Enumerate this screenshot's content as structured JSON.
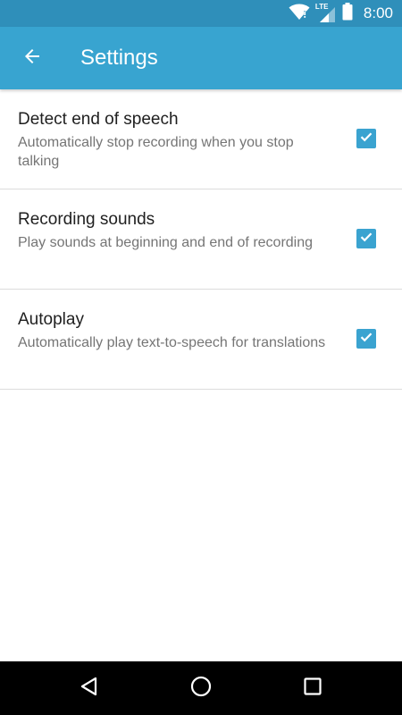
{
  "status_bar": {
    "time": "8:00",
    "network_label": "LTE",
    "icons": [
      "wifi-icon",
      "cell-signal-icon",
      "battery-icon"
    ],
    "background_color": "#2f8fba"
  },
  "app_bar": {
    "title": "Settings",
    "back_icon": "arrow-back-icon",
    "background_color": "#38a4d0"
  },
  "settings": [
    {
      "title": "Detect end of speech",
      "summary": "Automatically stop recording when you stop talking",
      "checked": true
    },
    {
      "title": "Recording sounds",
      "summary": "Play sounds at beginning and end of recording",
      "checked": true
    },
    {
      "title": "Autoplay",
      "summary": "Automatically play text-to-speech for translations",
      "checked": true
    }
  ],
  "nav_bar": {
    "buttons": [
      "back-triangle-icon",
      "home-circle-icon",
      "recents-square-icon"
    ]
  },
  "colors": {
    "accent": "#3aa3d0",
    "divider": "#dcdcdc",
    "title_text": "#1f1f1f",
    "summary_text": "#757575"
  }
}
